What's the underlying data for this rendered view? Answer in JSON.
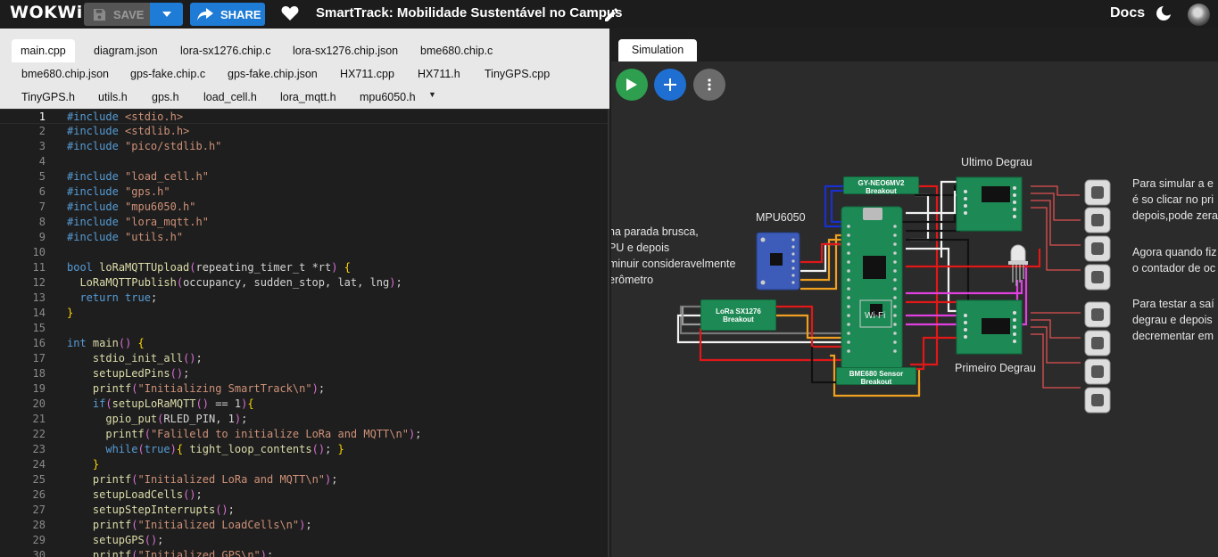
{
  "app": {
    "logo": "WOKWi",
    "project_title": "SmartTrack: Mobilidade Sustentável no Campus"
  },
  "toolbar": {
    "save_label": "SAVE",
    "share_label": "SHARE",
    "docs_label": "Docs"
  },
  "editor": {
    "tabs_row1": [
      "main.cpp",
      "diagram.json",
      "lora-sx1276.chip.c",
      "lora-sx1276.chip.json",
      "bme680.chip.c"
    ],
    "tabs_row2": [
      "bme680.chip.json",
      "gps-fake.chip.c",
      "gps-fake.chip.json",
      "HX711.cpp",
      "HX711.h",
      "TinyGPS.cpp"
    ],
    "tabs_row3": [
      "TinyGPS.h",
      "utils.h",
      "gps.h",
      "load_cell.h",
      "lora_mqtt.h",
      "mpu6050.h"
    ],
    "active_tab": "main.cpp",
    "lines": [
      [
        "1",
        "#include <stdio.h>"
      ],
      [
        "2",
        "#include <stdlib.h>"
      ],
      [
        "3",
        "#include \"pico/stdlib.h\""
      ],
      [
        "4",
        ""
      ],
      [
        "5",
        "#include \"load_cell.h\""
      ],
      [
        "6",
        "#include \"gps.h\""
      ],
      [
        "7",
        "#include \"mpu6050.h\""
      ],
      [
        "8",
        "#include \"lora_mqtt.h\""
      ],
      [
        "9",
        "#include \"utils.h\""
      ],
      [
        "10",
        ""
      ],
      [
        "11",
        "bool loRaMQTTUpload(repeating_timer_t *rt) {"
      ],
      [
        "12",
        "  LoRaMQTTPublish(occupancy, sudden_stop, lat, lng);"
      ],
      [
        "13",
        "  return true;"
      ],
      [
        "14",
        "}"
      ],
      [
        "15",
        ""
      ],
      [
        "16",
        "int main() {"
      ],
      [
        "17",
        "    stdio_init_all();"
      ],
      [
        "18",
        "    setupLedPins();"
      ],
      [
        "19",
        "    printf(\"Initializing SmartTrack\\n\");"
      ],
      [
        "20",
        "    if(setupLoRaMQTT() == 1){"
      ],
      [
        "21",
        "      gpio_put(RLED_PIN, 1);"
      ],
      [
        "22",
        "      printf(\"Falileld to initialize LoRa and MQTT\\n\");"
      ],
      [
        "23",
        "      while(true){ tight_loop_contents(); }"
      ],
      [
        "24",
        "    }"
      ],
      [
        "25",
        "    printf(\"Initialized LoRa and MQTT\\n\");"
      ],
      [
        "26",
        "    setupLoadCells();"
      ],
      [
        "27",
        "    setupStepInterrupts();"
      ],
      [
        "28",
        "    printf(\"Initialized LoadCells\\n\");"
      ],
      [
        "29",
        "    setupGPS();"
      ],
      [
        "30",
        "    printf(\"Initialized GPS\\n\");"
      ]
    ]
  },
  "simulation": {
    "tab_label": "Simulation",
    "left_text": [
      "na parada brusca,",
      "PU e depois",
      "minuir consideravelmente",
      "erômetro"
    ],
    "right_text_1": [
      "Para simular a e",
      "é so clicar no pri",
      "depois,pode zera"
    ],
    "right_text_2": [
      "Agora quando fiz",
      "o contador de oc"
    ],
    "right_text_3": [
      "Para testar a saí",
      "degrau e depois",
      "decrementar em"
    ],
    "labels": {
      "mpu": "MPU6050",
      "ultimo": "Ultimo Degrau",
      "primeiro": "Primeiro Degrau"
    },
    "modules": {
      "gps": [
        "GY-NEO6MV2",
        "Breakout"
      ],
      "lora": [
        "LoRa SX1276",
        "Breakout"
      ],
      "bme": [
        "BME680 Sensor",
        "Breakout"
      ],
      "pico_wifi": "Wi-Fi"
    }
  },
  "colors": {
    "accent": "#1e7bd6",
    "play": "#2e9e4f",
    "add": "#1e6fd1",
    "menu": "#6b6b6b",
    "board": "#1d8a55"
  }
}
